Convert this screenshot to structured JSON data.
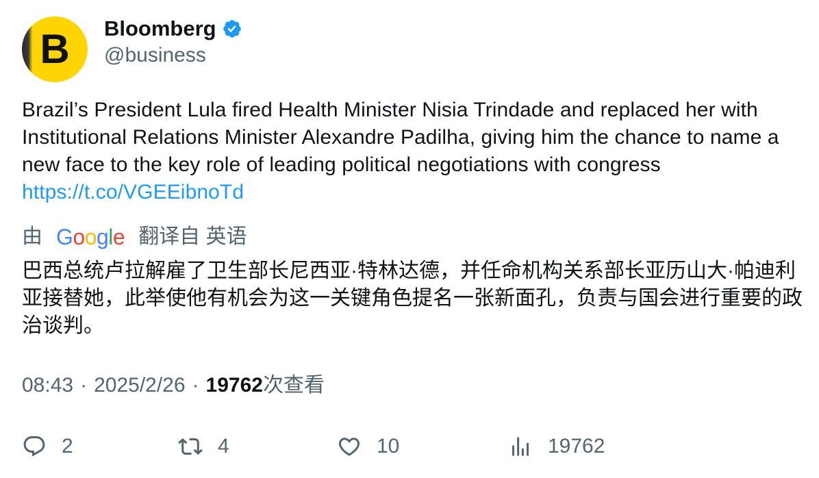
{
  "author": {
    "avatar_letter": "B",
    "display_name": "Bloomberg",
    "handle": "@business",
    "verified": true
  },
  "tweet": {
    "text": "Brazil’s President Lula fired Health Minister Nisia Trindade and replaced her with Institutional Relations Minister Alexandre Padilha, giving him the chance to name a new face to the key role of leading political negotiations with congress",
    "link": "https://t.co/VGEEibnoTd"
  },
  "translation": {
    "prefix": "由",
    "google_letters": [
      "G",
      "o",
      "o",
      "g",
      "l",
      "e"
    ],
    "suffix": "翻译自 英语",
    "text": "巴西总统卢拉解雇了卫生部长尼西亚·特林达德，并任命机构关系部长亚历山大·帕迪利亚接替她，此举使他有机会为这一关键角色提名一张新面孔，负责与国会进行重要的政治谈判。"
  },
  "meta": {
    "time": "08:43",
    "date": "2025/2/26",
    "views_count": "19762",
    "views_label": "次查看"
  },
  "actions": {
    "replies": "2",
    "retweets": "4",
    "likes": "10",
    "views": "19762"
  },
  "colors": {
    "text": "#0f1419",
    "secondary": "#536471",
    "link": "#1d9bf0",
    "avatar_bg": "#ffd400",
    "verified": "#1d9bf0"
  },
  "icons": [
    "verified-badge-icon",
    "reply-icon",
    "retweet-icon",
    "like-icon",
    "views-icon"
  ]
}
